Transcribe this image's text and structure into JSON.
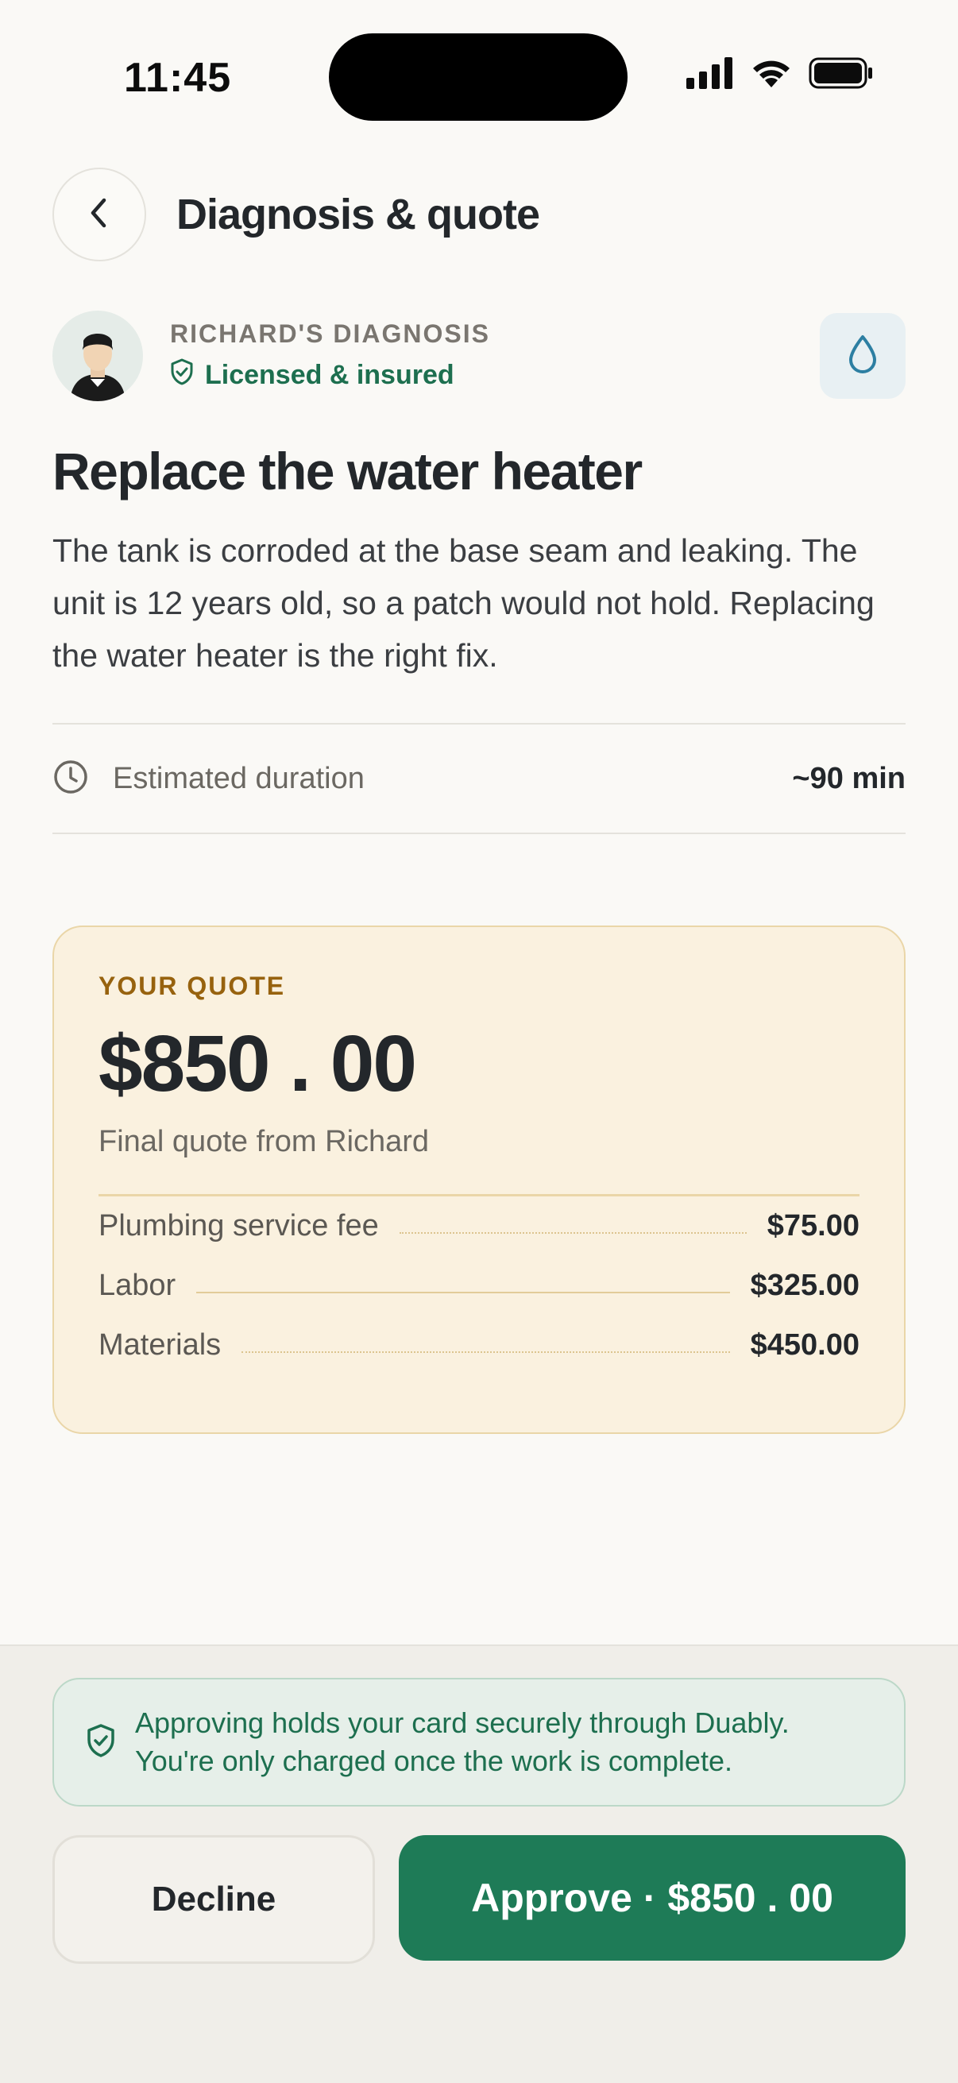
{
  "status_bar": {
    "time": "11:45"
  },
  "header": {
    "title": "Diagnosis & quote"
  },
  "pro": {
    "eyebrow": "RICHARD'S DIAGNOSIS",
    "badge": "Licensed & insured",
    "trade_icon": "water-drop-icon"
  },
  "diagnosis": {
    "title": "Replace the water heater",
    "body": "The tank is corroded at the base seam and leaking. The unit is 12 years old, so a patch would not hold. Replacing the water heater is the right fix.",
    "duration_label": "Estimated duration",
    "duration_value": "~90 min"
  },
  "quote": {
    "eyebrow": "YOUR QUOTE",
    "amount": "$850 . 00",
    "subtitle": "Final quote from Richard",
    "line_items": [
      {
        "label": "Plumbing service fee",
        "value": "$75.00"
      },
      {
        "label": "Labor",
        "value": "$325.00"
      },
      {
        "label": "Materials",
        "value": "$450.00"
      }
    ]
  },
  "footer": {
    "notice": "Approving holds your card securely through Duably. You're only charged once the work is complete.",
    "decline_label": "Decline",
    "approve_label": "Approve · $850 . 00"
  },
  "colors": {
    "accent_green": "#1e7b57",
    "quote_bg": "#faf1df",
    "eyebrow_gold": "#97620e"
  }
}
